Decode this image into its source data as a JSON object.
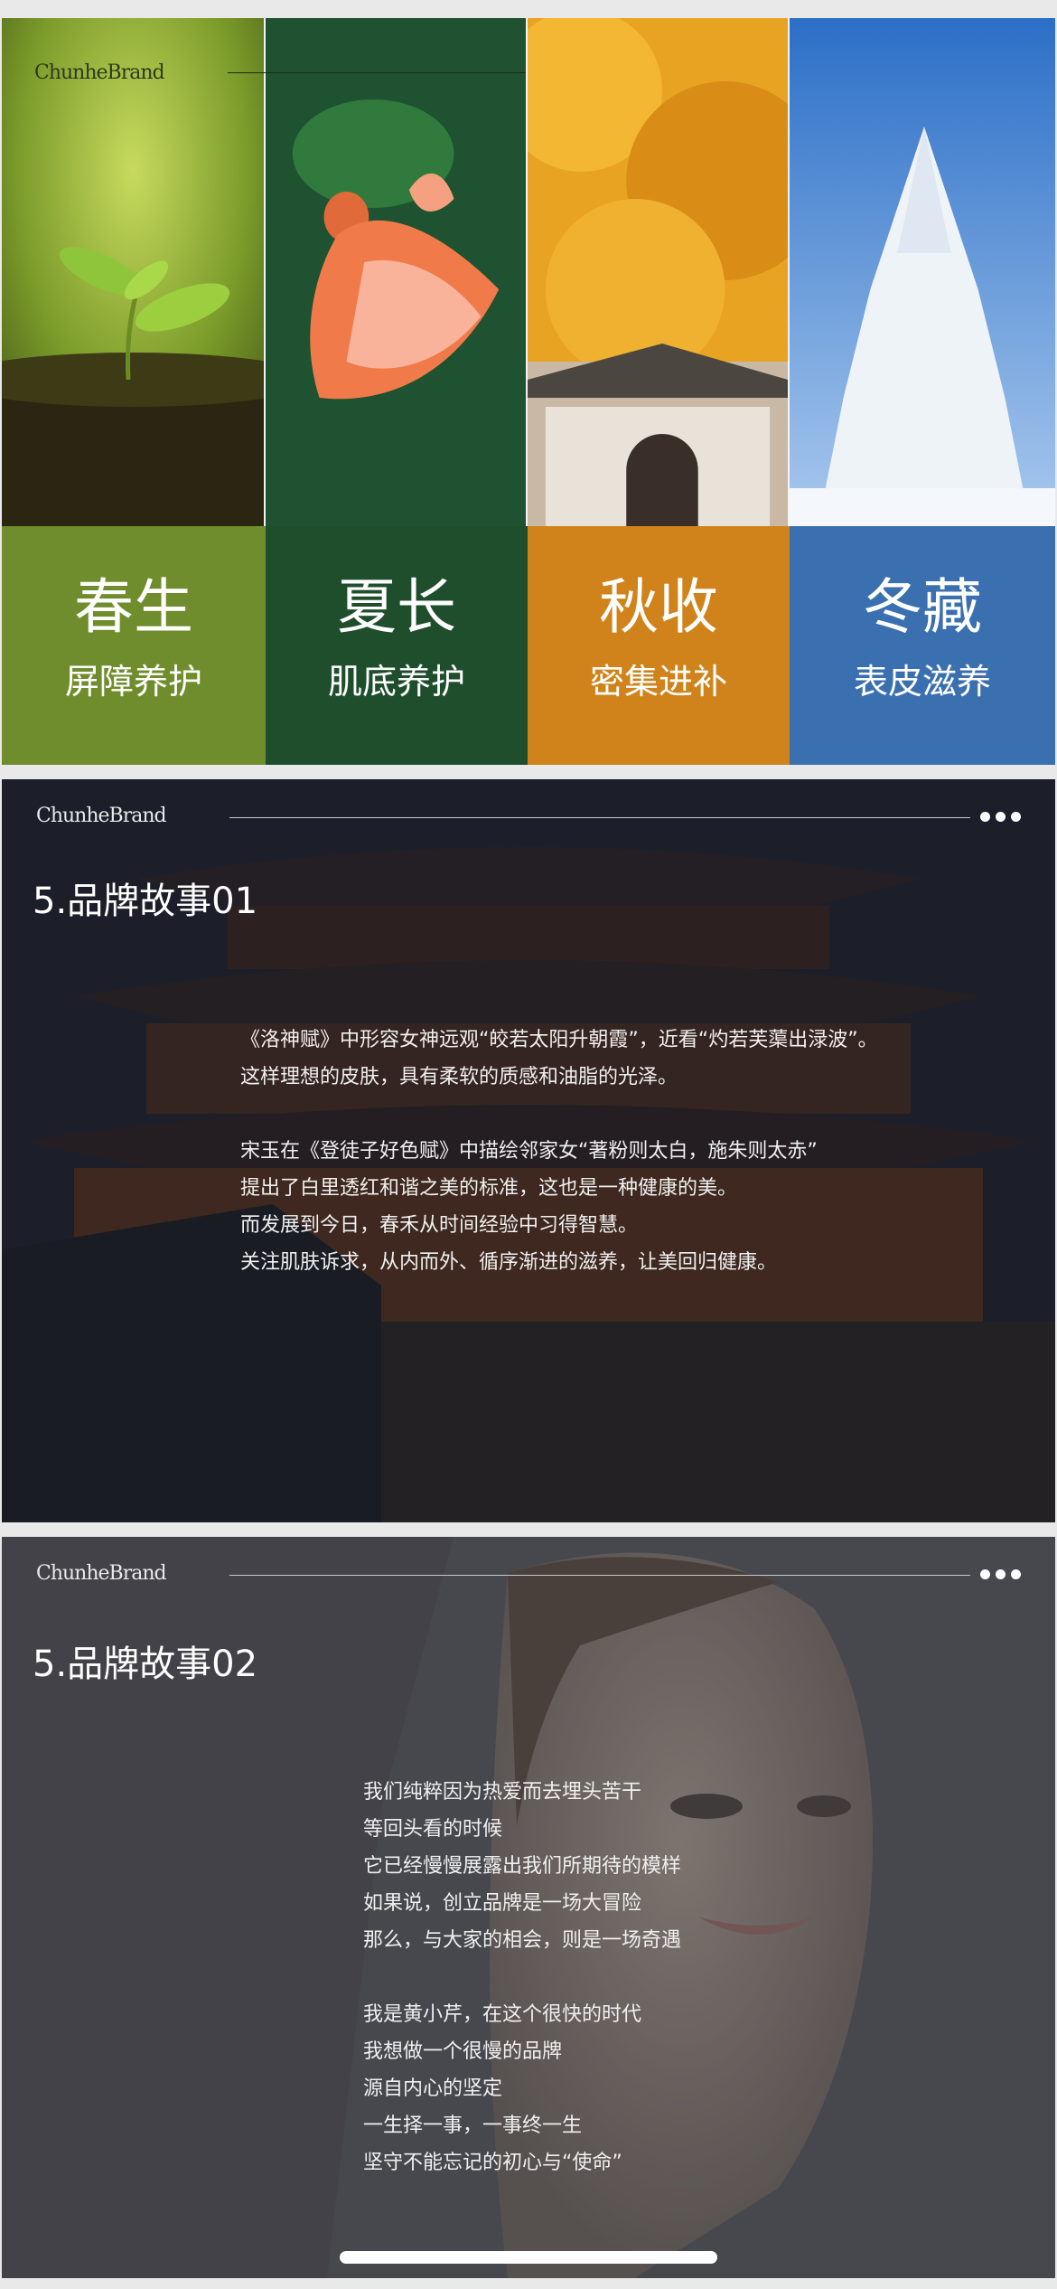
{
  "brand": "ChunheBrand",
  "seasons": [
    {
      "name": "春生",
      "care": "屏障养护",
      "color": "#6f8d2c"
    },
    {
      "name": "夏长",
      "care": "肌底养护",
      "color": "#1f4e2c"
    },
    {
      "name": "秋收",
      "care": "密集进补",
      "color": "#d0831a"
    },
    {
      "name": "冬藏",
      "care": "表皮滋养",
      "color": "#3a6fb0"
    }
  ],
  "story1": {
    "title": "5.品牌故事01",
    "lines": [
      "《洛神赋》中形容女神远观“皎若太阳升朝霞”，近看“灼若芙蕖出渌波”。",
      "这样理想的皮肤，具有柔软的质感和油脂的光泽。",
      "",
      "宋玉在《登徒子好色赋》中描绘邻家女“著粉则太白，施朱则太赤”",
      "提出了白里透红和谐之美的标准，这也是一种健康的美。",
      "而发展到今日，春禾从时间经验中习得智慧。",
      "关注肌肤诉求，从内而外、循序渐进的滋养，让美回归健康。"
    ]
  },
  "story2": {
    "title": "5.品牌故事02",
    "lines": [
      "我们纯粹因为热爱而去埋头苦干",
      "等回头看的时候",
      "它已经慢慢展露出我们所期待的模样",
      "如果说，创立品牌是一场大冒险",
      "那么，与大家的相会，则是一场奇遇",
      "",
      "我是黄小芹，在这个很快的时代",
      "我想做一个很慢的品牌",
      "源自内心的坚定",
      "一生择一事，一事终一生",
      "坚守不能忘记的初心与“使命”"
    ]
  },
  "icons": {
    "menu": "more-dots-icon"
  }
}
